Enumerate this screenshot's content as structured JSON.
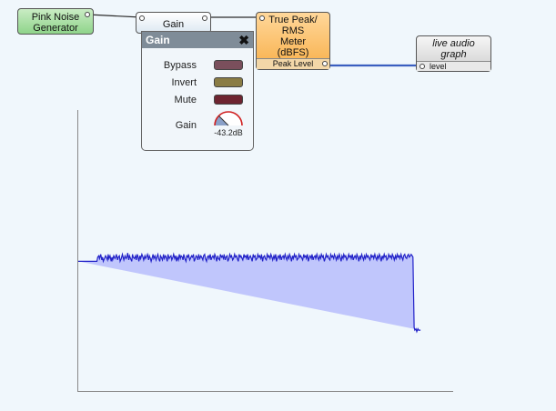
{
  "nodes": {
    "pink_noise": {
      "title_line1": "Pink Noise",
      "title_line2": "Generator"
    },
    "gain": {
      "title": "Gain"
    },
    "meter": {
      "line1": "True Peak/",
      "line2": "RMS",
      "line3": "Meter",
      "line4": "(dBFS)",
      "port_label": "Peak Level"
    },
    "graph": {
      "line1": "live audio",
      "line2": "graph",
      "port_label": "level"
    }
  },
  "gain_panel": {
    "title": "Gain",
    "close_symbol": "✖",
    "buttons": [
      {
        "label": "Bypass",
        "color": "#7a4f5c"
      },
      {
        "label": "Invert",
        "color": "#8a7c44"
      },
      {
        "label": "Mute",
        "color": "#6e2430"
      }
    ],
    "knob": {
      "label": "Gain",
      "readout": "-43.2dB",
      "fraction": 0.25,
      "ring_color": "#d02020",
      "fill_color": "#8aa0c8"
    }
  },
  "colors": {
    "wire": "#2b2b2b",
    "graph_wire": "#3a5ec0",
    "graph_fill": "#c0c6fc",
    "graph_line": "#2222c8"
  },
  "chart_data": {
    "type": "area",
    "x": [
      0,
      5,
      10,
      15,
      20,
      25,
      30,
      35,
      40,
      45,
      50,
      52,
      55,
      57,
      60,
      63,
      65,
      67,
      70,
      73,
      75,
      78,
      80,
      82,
      85,
      88,
      90,
      92,
      95,
      98,
      100,
      102,
      105,
      107,
      110,
      112,
      115,
      118,
      120,
      122,
      125,
      128,
      130,
      132,
      135,
      137,
      140,
      143,
      145,
      147,
      150,
      153,
      155,
      158,
      160,
      162,
      165,
      167,
      170,
      173,
      175,
      178,
      180,
      182,
      185,
      188,
      190,
      193,
      195,
      198,
      200,
      202,
      205,
      208,
      210,
      213,
      215,
      218,
      220,
      222,
      225,
      228,
      230,
      233,
      235,
      238,
      240,
      243,
      245,
      248,
      250,
      253,
      255,
      258,
      260,
      263,
      265,
      268,
      270,
      273,
      275,
      278,
      280,
      282,
      285,
      288,
      290,
      293,
      295,
      298,
      300,
      303,
      305,
      308,
      310,
      313,
      315,
      318,
      320,
      322,
      325,
      328,
      330,
      333,
      335,
      338,
      340,
      343,
      345,
      348,
      350,
      353,
      355,
      358,
      360,
      363,
      365,
      368,
      370,
      373,
      375,
      378,
      380,
      383,
      385,
      388,
      390,
      393,
      395,
      398,
      400,
      403,
      405,
      408,
      410,
      413,
      415,
      418,
      420,
      423,
      425,
      428,
      430,
      433,
      435,
      438,
      440,
      443,
      445,
      448,
      450,
      453,
      455,
      458,
      460,
      463,
      465,
      468,
      470,
      473,
      475,
      478,
      480,
      483,
      485,
      488,
      490,
      493,
      495,
      498,
      500,
      503,
      505,
      508,
      510,
      513,
      515,
      518,
      520,
      523,
      525,
      528,
      530,
      533,
      535,
      538,
      540,
      543,
      545,
      548,
      550,
      553,
      555,
      558,
      560,
      563,
      565,
      568,
      570,
      573,
      575,
      578,
      580,
      583,
      585,
      588,
      590,
      593,
      595,
      598,
      600,
      603,
      605,
      608,
      610,
      613,
      615,
      618,
      620,
      623,
      625,
      628,
      630,
      633,
      635,
      638,
      640,
      643,
      645,
      648,
      650,
      653,
      655,
      658,
      660,
      663,
      665,
      668,
      670,
      673,
      675,
      678,
      680,
      683,
      685,
      688,
      690,
      693,
      695,
      698,
      700,
      703,
      705,
      708,
      710,
      713,
      715,
      718,
      720,
      723,
      725,
      728,
      730,
      733,
      735,
      738,
      740,
      743,
      745,
      748,
      750,
      753,
      755,
      758,
      760,
      763,
      765,
      768,
      770,
      773,
      775,
      778,
      780,
      783,
      785,
      788,
      790,
      793,
      795,
      798,
      800,
      803,
      805,
      808,
      810,
      813,
      815,
      818,
      820,
      823,
      825,
      828,
      830,
      833,
      835,
      838,
      840,
      843,
      845,
      848,
      850,
      853,
      855,
      858,
      860,
      863,
      865,
      868,
      870,
      873,
      875,
      878,
      880,
      883,
      885,
      888,
      890,
      893,
      895,
      898,
      900,
      903,
      905,
      908,
      910,
      913,
      915,
      918,
      920,
      923,
      925,
      928,
      930,
      933,
      935,
      938,
      940,
      943,
      945,
      948,
      950,
      955,
      958,
      960,
      965,
      970,
      975,
      980,
      985,
      990,
      995,
      1000
    ],
    "values": [
      -43,
      -43,
      -43,
      -43,
      -43,
      -43,
      -43,
      -43,
      -43,
      -43,
      -43,
      -40,
      -39,
      -41,
      -38,
      -42,
      -40,
      -43,
      -41,
      -39,
      -40,
      -42,
      -38,
      -41,
      -39,
      -43,
      -40,
      -42,
      -39,
      -41,
      -40,
      -38,
      -42,
      -40,
      -39,
      -43,
      -41,
      -38,
      -40,
      -42,
      -39,
      -41,
      -40,
      -37,
      -42,
      -39,
      -41,
      -43,
      -38,
      -40,
      -41,
      -39,
      -42,
      -38,
      -40,
      -43,
      -39,
      -41,
      -38,
      -40,
      -42,
      -39,
      -41,
      -40,
      -38,
      -42,
      -39,
      -41,
      -43,
      -40,
      -38,
      -41,
      -39,
      -42,
      -40,
      -38,
      -41,
      -43,
      -39,
      -40,
      -42,
      -38,
      -41,
      -39,
      -40,
      -43,
      -38,
      -41,
      -40,
      -39,
      -42,
      -40,
      -38,
      -41,
      -39,
      -43,
      -40,
      -42,
      -38,
      -41,
      -39,
      -40,
      -42,
      -38,
      -41,
      -43,
      -39,
      -40,
      -38,
      -42,
      -41,
      -39,
      -40,
      -38,
      -43,
      -41,
      -39,
      -40,
      -42,
      -38,
      -41,
      -39,
      -40,
      -42,
      -39,
      -38,
      -41,
      -43,
      -40,
      -39,
      -41,
      -38,
      -42,
      -40,
      -39,
      -41,
      -38,
      -40,
      -43,
      -39,
      -41,
      -42,
      -38,
      -40,
      -39,
      -41,
      -38,
      -42,
      -40,
      -39,
      -43,
      -41,
      -38,
      -40,
      -39,
      -42,
      -41,
      -38,
      -40,
      -39,
      -41,
      -43,
      -38,
      -40,
      -39,
      -41,
      -42,
      -38,
      -40,
      -39,
      -41,
      -38,
      -42,
      -40,
      -39,
      -41,
      -43,
      -38,
      -40,
      -39,
      -42,
      -41,
      -38,
      -40,
      -39,
      -41,
      -38,
      -43,
      -40,
      -39,
      -41,
      -42,
      -38,
      -40,
      -39,
      -41,
      -38,
      -40,
      -42,
      -39,
      -41,
      -38,
      -43,
      -40,
      -39,
      -41,
      -38,
      -42,
      -40,
      -39,
      -41,
      -38,
      -40,
      -42,
      -39,
      -41,
      -38,
      -40,
      -43,
      -39,
      -41,
      -38,
      -40,
      -39,
      -42,
      -41,
      -38,
      -40,
      -39,
      -41,
      -42,
      -38,
      -40,
      -39,
      -41,
      -38,
      -43,
      -40,
      -39,
      -41,
      -38,
      -42,
      -40,
      -39,
      -41,
      -38,
      -40,
      -42,
      -39,
      -41,
      -38,
      -40,
      -39,
      -43,
      -41,
      -38,
      -40,
      -39,
      -41,
      -42,
      -38,
      -40,
      -39,
      -41,
      -38,
      -40,
      -42,
      -39,
      -41,
      -38,
      -40,
      -43,
      -39,
      -41,
      -38,
      -40,
      -39,
      -42,
      -41,
      -38,
      -40,
      -39,
      -41,
      -38,
      -42,
      -40,
      -39,
      -41,
      -38,
      -40,
      -43,
      -39,
      -41,
      -38,
      -40,
      -42,
      -39,
      -41,
      -38,
      -40,
      -39,
      -41,
      -42,
      -38,
      -40,
      -39,
      -41,
      -38,
      -40,
      -42,
      -39,
      -41,
      -38,
      -40,
      -43,
      -39,
      -41,
      -38,
      -40,
      -39,
      -42,
      -41,
      -38,
      -40,
      -39,
      -41,
      -38,
      -40,
      -42,
      -39,
      -41,
      -38,
      -40,
      -39,
      -41,
      -38,
      -40,
      -42,
      -39,
      -38,
      -40,
      -41,
      -39,
      -38,
      -40,
      -39,
      -38,
      -39,
      -40,
      -90,
      -92,
      -91,
      -93,
      -91,
      -92,
      -92,
      -92
    ],
    "xlim": [
      0,
      1000
    ],
    "ylim": [
      -100,
      0
    ],
    "grid": false
  }
}
